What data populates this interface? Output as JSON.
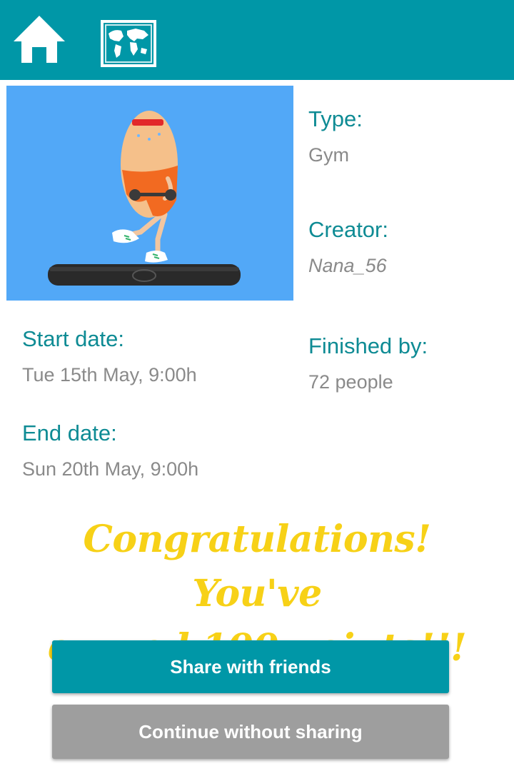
{
  "icons": {
    "home": "home-icon",
    "map": "world-map-icon"
  },
  "colors": {
    "primary": "#0097a7",
    "label": "#0e8b94",
    "value": "#8a8a8a",
    "congrats": "#f7d117",
    "secondary_button": "#9e9e9e",
    "illustration_bg": "#52a8f7"
  },
  "details": {
    "type_label": "Type:",
    "type_value": "Gym",
    "creator_label": "Creator:",
    "creator_value": "Nana_56",
    "start_label": "Start date:",
    "start_value": "Tue 15th May, 9:00h",
    "finished_label": "Finished by:",
    "finished_value": "72 people",
    "end_label": "End date:",
    "end_value": "Sun 20th May, 9:00h"
  },
  "congrats": {
    "line1": "Congratulations! You've",
    "line2": "earned 100 points!!!"
  },
  "buttons": {
    "share": "Share with friends",
    "continue": "Continue without sharing"
  }
}
